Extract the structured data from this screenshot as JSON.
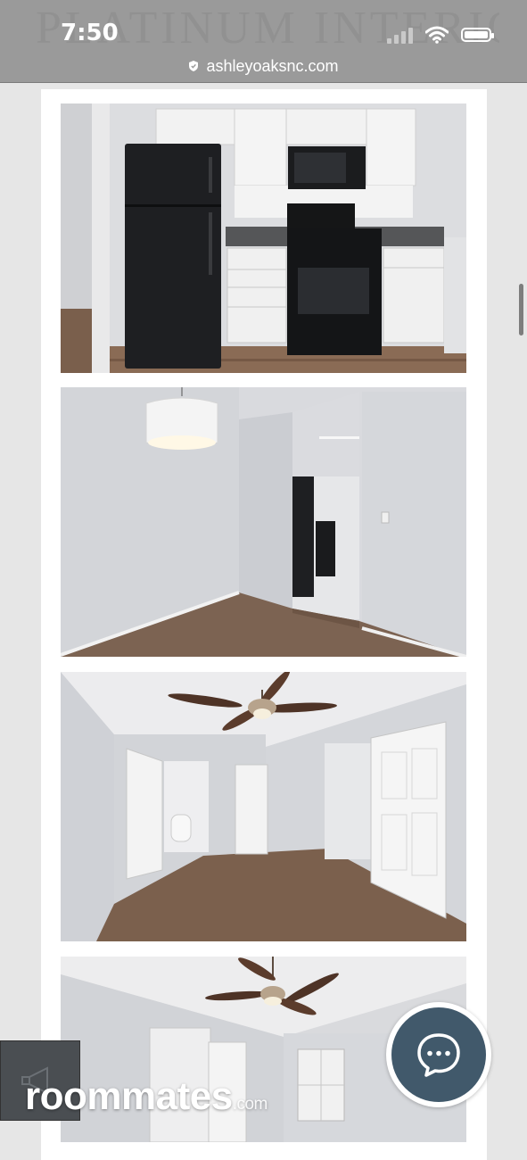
{
  "status_bar": {
    "time": "7:50",
    "signal_icon": "cellular-signal-icon",
    "wifi_icon": "wifi-icon",
    "battery_icon": "battery-icon"
  },
  "address_bar": {
    "url": "ashleyoaksnc.com",
    "lock_icon": "lock-icon",
    "background_text": "PLATINUM INTERIORS"
  },
  "gallery": {
    "photos": [
      {
        "subject": "kitchen"
      },
      {
        "subject": "dining-area"
      },
      {
        "subject": "bedroom-with-ceiling-fan"
      },
      {
        "subject": "bedroom-with-closet"
      }
    ]
  },
  "chat_button": {
    "icon": "chat-bubble-icon"
  },
  "watermark": {
    "brand": "roommates",
    "suffix": ".com"
  },
  "colors": {
    "chat_bg": "#41596b",
    "topbar": "#9a9a9a",
    "page_bg": "#e6e6e6"
  }
}
